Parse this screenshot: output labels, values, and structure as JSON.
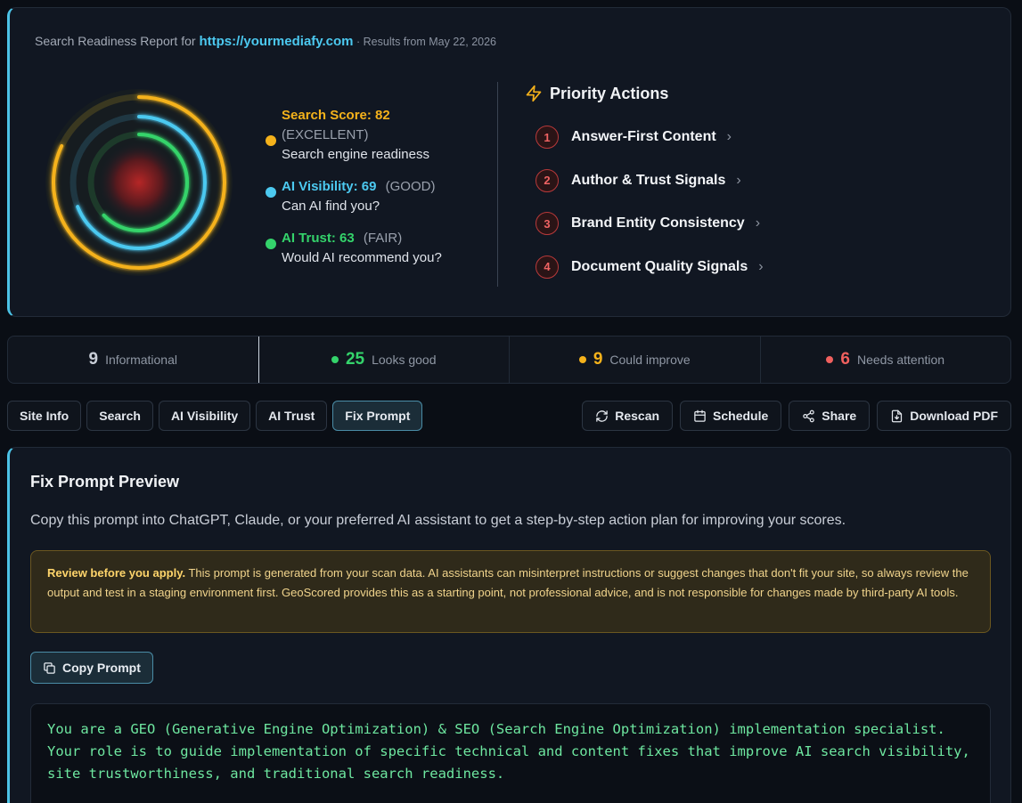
{
  "report": {
    "title_prefix": "Search Readiness Report for ",
    "url": "https://yourmediafy.com",
    "date_text": " · Results from May 22, 2026"
  },
  "scores": [
    {
      "label": "Search Score: 82",
      "rating": "(EXCELLENT)",
      "desc": "Search engine readiness",
      "value": 82,
      "color": "#f5b21b"
    },
    {
      "label": "AI Visibility: 69",
      "rating": "(GOOD)",
      "desc": "Can AI find you?",
      "value": 69,
      "color": "#4cc9f0"
    },
    {
      "label": "AI Trust: 63",
      "rating": "(FAIR)",
      "desc": "Would AI recommend you?",
      "value": 63,
      "color": "#34d36b"
    }
  ],
  "priority": {
    "title": "Priority Actions",
    "icon": "lightning-icon",
    "items": [
      {
        "num": "1",
        "label": "Answer-First Content"
      },
      {
        "num": "2",
        "label": "Author & Trust Signals"
      },
      {
        "num": "3",
        "label": "Brand Entity Consistency"
      },
      {
        "num": "4",
        "label": "Document Quality Signals"
      }
    ]
  },
  "stats": [
    {
      "num": "9",
      "label": "Informational",
      "color": "#c9ced8"
    },
    {
      "num": "25",
      "label": "Looks good",
      "color": "#34d36b"
    },
    {
      "num": "9",
      "label": "Could improve",
      "color": "#f5b21b"
    },
    {
      "num": "6",
      "label": "Needs attention",
      "color": "#f0605e"
    }
  ],
  "tabs": [
    "Site Info",
    "Search",
    "AI Visibility",
    "AI Trust",
    "Fix Prompt"
  ],
  "actions": {
    "rescan": "Rescan",
    "schedule": "Schedule",
    "share": "Share",
    "download": "Download PDF"
  },
  "panel": {
    "title": "Fix Prompt Preview",
    "desc": "Copy this prompt into ChatGPT, Claude, or your preferred AI assistant to get a step-by-step action plan for improving your scores.",
    "warn_bold": "Review before you apply.",
    "warn_text": " This prompt is generated from your scan data. AI assistants can misinterpret instructions or suggest changes that don't fit your site, so always review the output and test in a staging environment first. GeoScored provides this as a starting point, not professional advice, and is not responsible for changes made by third-party AI tools.",
    "copy_label": "Copy Prompt",
    "code": "You are a GEO (Generative Engine Optimization) & SEO (Search Engine Optimization) implementation specialist.\nYour role is to guide implementation of specific technical and content fixes that improve AI search visibility,\nsite trustworthiness, and traditional search readiness."
  }
}
